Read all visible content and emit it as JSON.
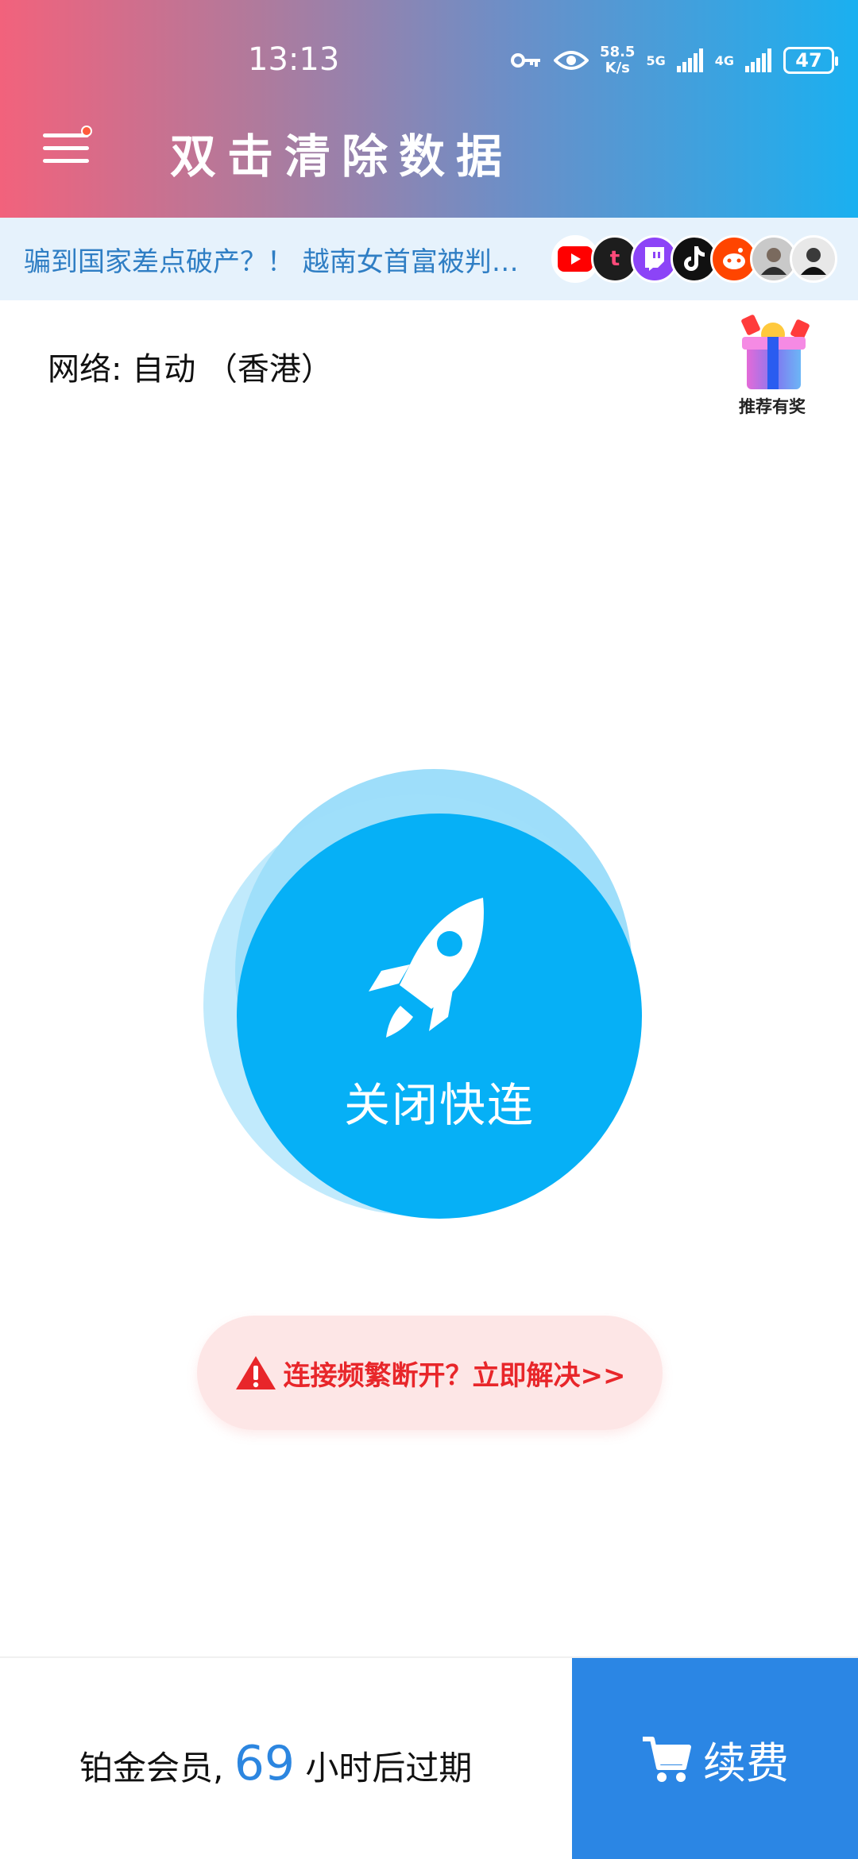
{
  "status_bar": {
    "time": "13:13",
    "net_speed_value": "58.5",
    "net_speed_unit": "K/s",
    "signal1": "5G",
    "signal2": "4G",
    "battery": "47"
  },
  "header": {
    "title": "双击清除数据",
    "menu_icon": "hamburger-menu-icon"
  },
  "ticker": {
    "text": "骗到国家差点破产？！ 越南女首富被判…",
    "avatars": [
      "youtube",
      "tumblr",
      "twitch",
      "tiktok",
      "reddit",
      "person",
      "person"
    ]
  },
  "network": {
    "label": "网络: 自动 （香港）"
  },
  "gift": {
    "label": "推荐有奖"
  },
  "connect": {
    "label": "关闭快连",
    "icon": "rocket-icon"
  },
  "warning": {
    "text": "连接频繁断开？立即解决>>"
  },
  "bottom": {
    "membership_prefix": "铂金会员, ",
    "hours": "69",
    "membership_suffix": " 小时后过期",
    "renew_label": "续费"
  },
  "colors": {
    "accent": "#06b0f6",
    "renew": "#2b86e4",
    "warning": "#e8262a"
  }
}
